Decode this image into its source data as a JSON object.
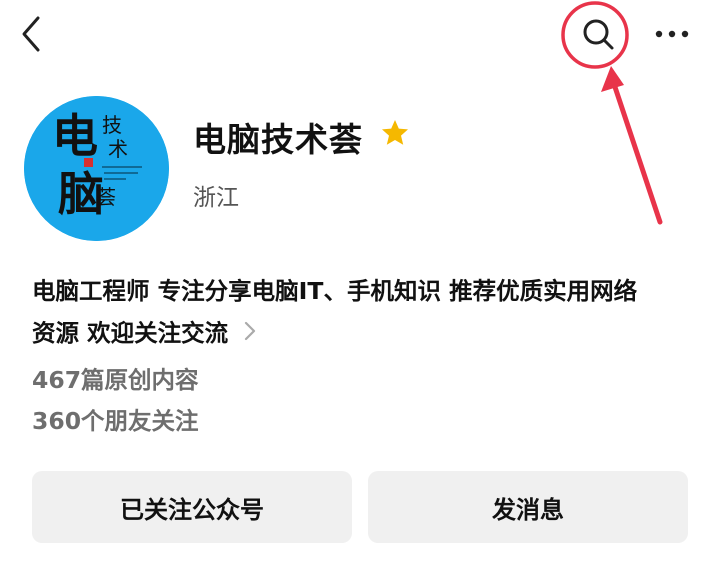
{
  "header": {
    "back_icon": "chevron-left-icon",
    "search_icon": "search-icon",
    "more_icon": "more-dots-icon"
  },
  "profile": {
    "name": "电脑技术荟",
    "verified_icon": "star-icon",
    "region": "浙江",
    "avatar": {
      "big_chars": [
        "电",
        "脑"
      ],
      "small_chars": [
        "技",
        "术",
        "荟"
      ]
    }
  },
  "bio": {
    "line1": "电脑工程师 专注分享电脑IT、手机知识 推荐优质实用网络",
    "line2": "资源 欢迎关注交流"
  },
  "stats": {
    "articles": "467篇原创内容",
    "friends": "360个朋友关注"
  },
  "actions": {
    "follow_label": "已关注公众号",
    "message_label": "发消息"
  },
  "colors": {
    "annotation": "#e8344a",
    "avatar_bg": "#1aa7ea",
    "star": "#f5b800",
    "button_bg": "#f0f0f0"
  }
}
